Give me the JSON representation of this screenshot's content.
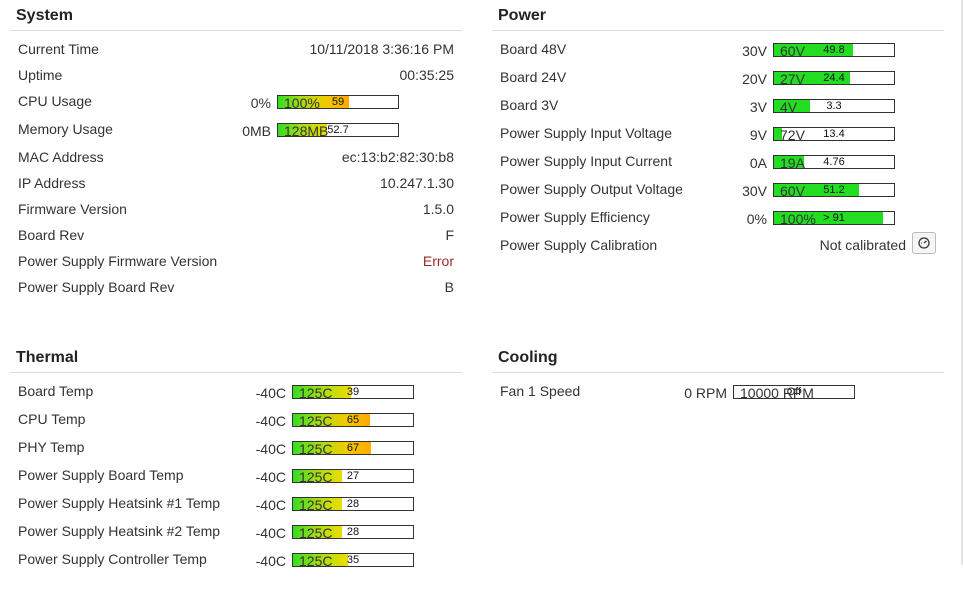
{
  "system": {
    "title": "System",
    "current_time_label": "Current Time",
    "current_time": "10/11/2018 3:36:16 PM",
    "uptime_label": "Uptime",
    "uptime": "00:35:25",
    "cpu_label": "CPU Usage",
    "cpu": {
      "min": "0%",
      "max": "100%",
      "text": "59",
      "fraction": 0.59
    },
    "mem_label": "Memory Usage",
    "mem": {
      "min": "0MB",
      "max": "128MB",
      "text": "52.7",
      "fraction": 0.41
    },
    "mac_label": "MAC Address",
    "mac": "ec:13:b2:82:30:b8",
    "ip_label": "IP Address",
    "ip": "10.247.1.30",
    "fw_label": "Firmware Version",
    "fw": "1.5.0",
    "board_rev_label": "Board Rev",
    "board_rev": "F",
    "ps_fw_label": "Power Supply Firmware Version",
    "ps_fw": "Error",
    "ps_board_rev_label": "Power Supply Board Rev",
    "ps_board_rev": "B"
  },
  "power": {
    "title": "Power",
    "rows": [
      {
        "label": "Board 48V",
        "min": "30V",
        "max": "60V",
        "text": "49.8",
        "fraction": 0.66
      },
      {
        "label": "Board 24V",
        "min": "20V",
        "max": "27V",
        "text": "24.4",
        "fraction": 0.63
      },
      {
        "label": "Board 3V",
        "min": "3V",
        "max": "4V",
        "text": "3.3",
        "fraction": 0.3
      },
      {
        "label": "Power Supply Input Voltage",
        "min": "9V",
        "max": "72V",
        "text": "13.4",
        "fraction": 0.07
      },
      {
        "label": "Power Supply Input Current",
        "min": "0A",
        "max": "19A",
        "text": "4.76",
        "fraction": 0.25
      },
      {
        "label": "Power Supply Output Voltage",
        "min": "30V",
        "max": "60V",
        "text": "51.2",
        "fraction": 0.71
      },
      {
        "label": "Power Supply Efficiency",
        "min": "0%",
        "max": "100%",
        "text": "> 91",
        "fraction": 0.91
      }
    ],
    "calib_label": "Power Supply Calibration",
    "calib_value": "Not calibrated"
  },
  "thermal": {
    "title": "Thermal",
    "min": "-40C",
    "max": "125C",
    "rows": [
      {
        "label": "Board Temp",
        "text": "39",
        "fraction": 0.48
      },
      {
        "label": "CPU Temp",
        "text": "65",
        "fraction": 0.64
      },
      {
        "label": "PHY Temp",
        "text": "67",
        "fraction": 0.65
      },
      {
        "label": "Power Supply Board Temp",
        "text": "27",
        "fraction": 0.41
      },
      {
        "label": "Power Supply Heatsink #1 Temp",
        "text": "28",
        "fraction": 0.41
      },
      {
        "label": "Power Supply Heatsink #2 Temp",
        "text": "28",
        "fraction": 0.41
      },
      {
        "label": "Power Supply Controller Temp",
        "text": "35",
        "fraction": 0.46
      }
    ]
  },
  "cooling": {
    "title": "Cooling",
    "fan_label": "Fan 1 Speed",
    "min": "0 RPM",
    "max": "10000 RPM",
    "text": "Off",
    "fraction": 0
  },
  "colors": {
    "ok": "#22dd22",
    "warn": "#ffaa00",
    "error": "#9b2a2a"
  },
  "icons": {
    "calibrate": "gauge-icon"
  }
}
